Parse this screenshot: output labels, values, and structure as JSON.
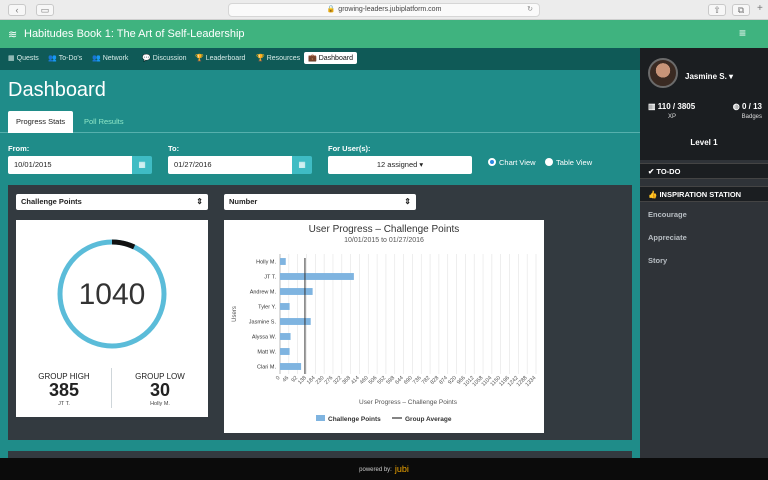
{
  "browser": {
    "url": "growing-leaders.jubiplatform.com"
  },
  "app": {
    "title": "Habitudes Book 1: The Art of Self-Leadership"
  },
  "nav": [
    {
      "label": "Quests",
      "icon": "grid-icon"
    },
    {
      "label": "To-Do's",
      "icon": "users-icon"
    },
    {
      "label": "Network",
      "icon": "users-icon"
    },
    {
      "label": "Discussion",
      "icon": "chat-icon"
    },
    {
      "label": "Leaderboard",
      "icon": "trophy-icon"
    },
    {
      "label": "Resources",
      "icon": "trophy-icon"
    },
    {
      "label": "Dashboard",
      "icon": "briefcase-icon",
      "active": true
    }
  ],
  "page": {
    "title": "Dashboard"
  },
  "tabs": {
    "active": "Progress Stats",
    "inactive": "Poll Results"
  },
  "filters": {
    "from_label": "From:",
    "from_value": "10/01/2015",
    "to_label": "To:",
    "to_value": "01/27/2016",
    "users_label": "For User(s):",
    "users_value": "12 assigned",
    "chart_view": "Chart View",
    "table_view": "Table View"
  },
  "selects": {
    "metric": "Challenge Points",
    "mode": "Number"
  },
  "stats": {
    "total": "1040",
    "gauge_fraction": 0.07,
    "high_label": "GROUP HIGH",
    "high_value": "385",
    "high_name": "JT T.",
    "low_label": "GROUP LOW",
    "low_value": "30",
    "low_name": "Holly M."
  },
  "chart_data": {
    "type": "bar",
    "orientation": "horizontal",
    "title": "User Progress – Challenge Points",
    "subtitle": "10/01/2015 to 01/27/2016",
    "ylabel": "Users",
    "xlabel": "User Progress – Challenge Points",
    "categories": [
      "Holly M.",
      "JT T.",
      "Andrew M.",
      "Tyler Y.",
      "Jasmine S.",
      "Alyssa W.",
      "Matt W.",
      "Clari M."
    ],
    "series": [
      {
        "name": "Challenge Points",
        "values": [
          30,
          385,
          170,
          50,
          160,
          55,
          50,
          110
        ]
      }
    ],
    "group_average": 130,
    "xlim": [
      0,
      1334
    ],
    "xticks": [
      0,
      46,
      92,
      138,
      184,
      230,
      276,
      322,
      368,
      414,
      460,
      506,
      552,
      598,
      644,
      690,
      736,
      782,
      828,
      874,
      920,
      966,
      1012,
      1058,
      1104,
      1150,
      1196,
      1242,
      1288,
      1334
    ],
    "legend": [
      "Challenge Points",
      "Group Average"
    ],
    "legend_position": "bottom",
    "grid": true,
    "colors": {
      "bar": "#7fb4e0",
      "average": "#333333"
    }
  },
  "sidebar": {
    "user_name": "Jasmine S.",
    "xp": "110 / 3805",
    "xp_label": "XP",
    "badges": "0 / 13",
    "badges_label": "Badges",
    "level": "Level 1",
    "todo": "TO-DO",
    "inspiration": "INSPIRATION STATION",
    "items": [
      "Encourage",
      "Appreciate",
      "Story"
    ]
  },
  "footer": {
    "powered": "powered by:",
    "brand": "jubi"
  },
  "colors": {
    "header": "#3fb37f",
    "main": "#1f8c89",
    "nav": "#0f5a57",
    "accent": "#3fbcc4",
    "gauge": "#5bbcd9"
  }
}
